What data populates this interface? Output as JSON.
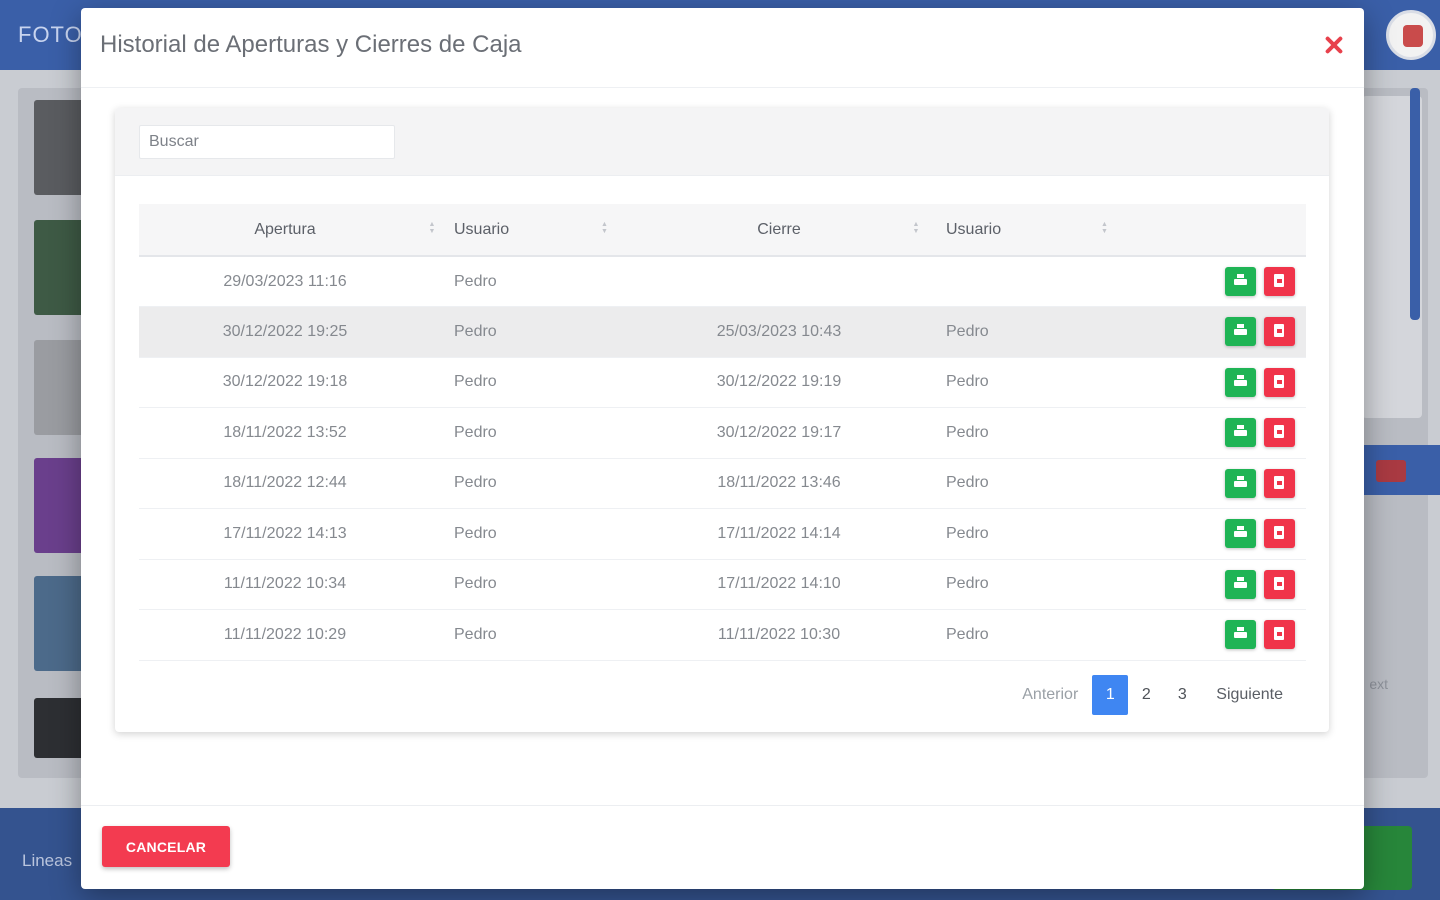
{
  "background": {
    "brand_partial": "FOTO",
    "footer_label_partial": "Lineas",
    "side_text_partial": "ext"
  },
  "modal": {
    "title": "Historial de Aperturas y Cierres de Caja",
    "search_placeholder": "Buscar",
    "columns": [
      "Apertura",
      "Usuario",
      "Cierre",
      "Usuario"
    ],
    "rows": [
      {
        "apertura": "29/03/2023 11:16",
        "usuario_apertura": "Pedro",
        "cierre": "",
        "usuario_cierre": ""
      },
      {
        "apertura": "30/12/2022 19:25",
        "usuario_apertura": "Pedro",
        "cierre": "25/03/2023 10:43",
        "usuario_cierre": "Pedro"
      },
      {
        "apertura": "30/12/2022 19:18",
        "usuario_apertura": "Pedro",
        "cierre": "30/12/2022 19:19",
        "usuario_cierre": "Pedro"
      },
      {
        "apertura": "18/11/2022 13:52",
        "usuario_apertura": "Pedro",
        "cierre": "30/12/2022 19:17",
        "usuario_cierre": "Pedro"
      },
      {
        "apertura": "18/11/2022 12:44",
        "usuario_apertura": "Pedro",
        "cierre": "18/11/2022 13:46",
        "usuario_cierre": "Pedro"
      },
      {
        "apertura": "17/11/2022 14:13",
        "usuario_apertura": "Pedro",
        "cierre": "17/11/2022 14:14",
        "usuario_cierre": "Pedro"
      },
      {
        "apertura": "11/11/2022 10:34",
        "usuario_apertura": "Pedro",
        "cierre": "17/11/2022 14:10",
        "usuario_cierre": "Pedro"
      },
      {
        "apertura": "11/11/2022 10:29",
        "usuario_apertura": "Pedro",
        "cierre": "11/11/2022 10:30",
        "usuario_cierre": "Pedro"
      }
    ],
    "row_actions": {
      "print_icon": "printer-icon",
      "pdf_icon": "pdf-icon",
      "print_color": "#1fb455",
      "pdf_color": "#f0344a"
    },
    "pagination": {
      "previous": "Anterior",
      "pages": [
        "1",
        "2",
        "3"
      ],
      "active_page": "1",
      "next": "Siguiente"
    },
    "cancel_label": "CANCELAR"
  },
  "colors": {
    "accent_blue": "#3f86f2",
    "danger": "#f0344a",
    "success": "#1fb455",
    "app_header": "#3a5fa8"
  }
}
